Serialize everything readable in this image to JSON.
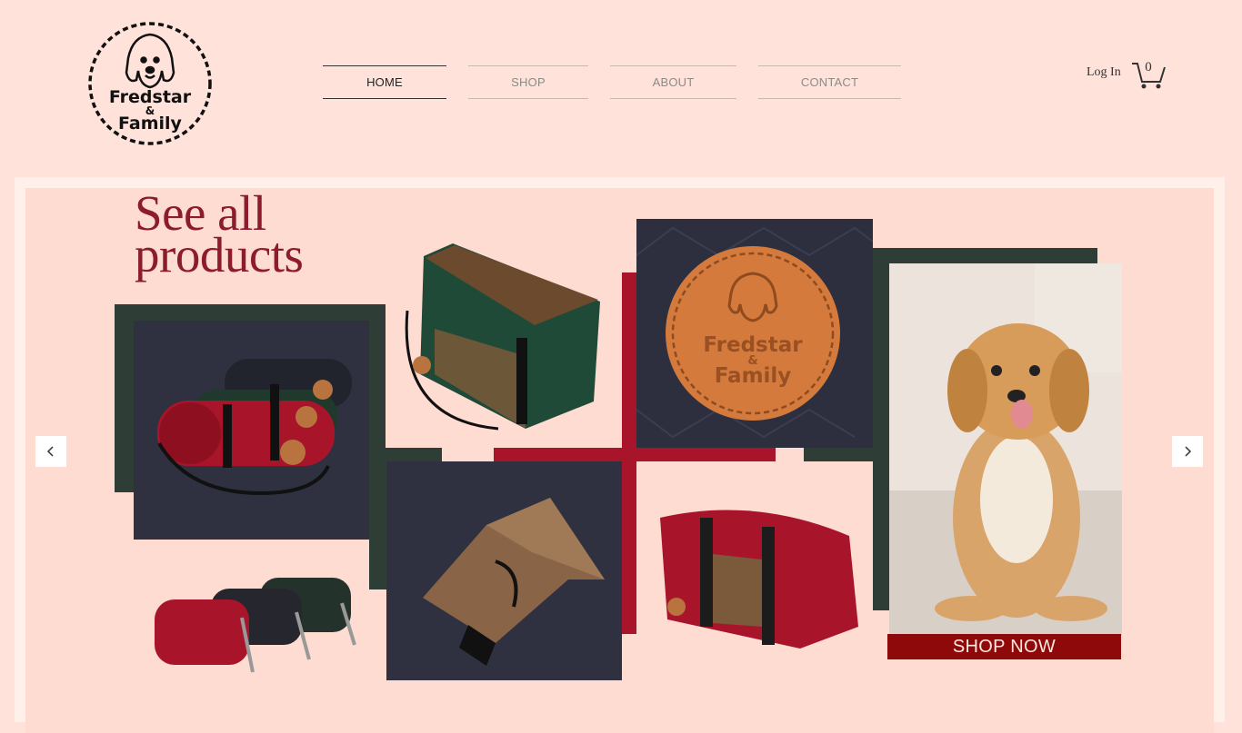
{
  "brand": {
    "name_line1": "Fredstar",
    "name_line2": "&",
    "name_line3": "Family"
  },
  "nav": {
    "items": [
      {
        "label": "HOME",
        "active": true
      },
      {
        "label": "SHOP",
        "active": false
      },
      {
        "label": "ABOUT",
        "active": false
      },
      {
        "label": "CONTACT",
        "active": false
      }
    ]
  },
  "header": {
    "login_label": "Log In",
    "cart_count": "0"
  },
  "gallery": {
    "headline_line1": "See all",
    "headline_line2": "products",
    "patch_line1": "Fredstar",
    "patch_line2": "&",
    "patch_line3": "Family",
    "cta_label": "SHOP NOW",
    "prev_icon": "chevron-left-icon",
    "next_icon": "chevron-right-icon"
  },
  "colors": {
    "page_bg": "#ffe2d9",
    "accent_red": "#8e0a0a",
    "crimson": "#a8152a",
    "dark_green": "#2f3d37",
    "navy_bg": "#2f3140",
    "headline": "#8c1b2b"
  }
}
